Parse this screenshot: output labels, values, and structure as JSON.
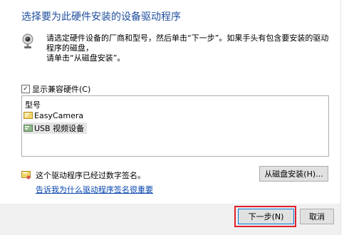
{
  "header": {
    "title": "选择要为此硬件安装的设备驱动程序"
  },
  "instructions": {
    "text": "请选定硬件设备的厂商和型号，然后单击“下一步”。如果手头有包含要安装的驱动程序的磁盘，\n请单击“从磁盘安装”。",
    "icon": "webcam-icon"
  },
  "compatible_checkbox": {
    "label": "显示兼容硬件(C)",
    "checked": true
  },
  "model_list": {
    "header": "型号",
    "items": [
      {
        "label": "EasyCamera",
        "icon": "driver-device-icon",
        "selected": false
      },
      {
        "label": "USB 视频设备",
        "icon": "driver-device-icon",
        "selected": true
      }
    ]
  },
  "signature": {
    "text": "这个驱动程序已经过数字签名。",
    "icon": "signed-driver-icon",
    "link": "告诉我为什么驱动程序签名很重要"
  },
  "buttons": {
    "have_disk": "从磁盘安装(H)...",
    "next": "下一步(N)",
    "cancel": "取消"
  },
  "colors": {
    "title": "#1f4e9e",
    "link": "#0645ad",
    "highlight": "#e0202a",
    "footer": "#f0f0f0"
  }
}
